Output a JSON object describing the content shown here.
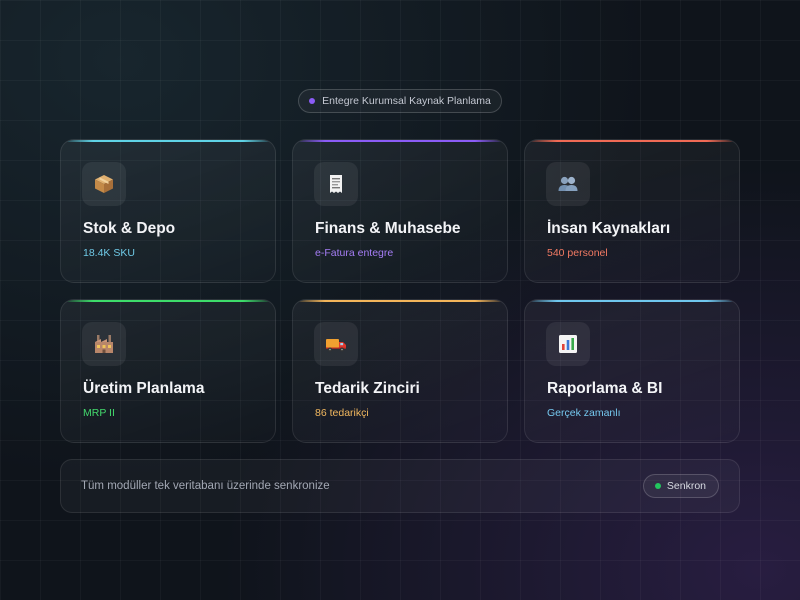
{
  "header": {
    "pill_label": "Entegre Kurumsal Kaynak Planlama",
    "dot_color": "#8b5cf6"
  },
  "modules": [
    {
      "title": "Stok & Depo",
      "subtitle": "18.4K SKU",
      "accent": "#5fd3e6",
      "sub_color": "#6fc9e6",
      "icon": "package-icon"
    },
    {
      "title": "Finans & Muhasebe",
      "subtitle": "e-Fatura entegre",
      "accent": "#8b5cf6",
      "sub_color": "#a57df5",
      "icon": "receipt-icon"
    },
    {
      "title": "İnsan Kaynakları",
      "subtitle": "540 personel",
      "accent": "#f06a55",
      "sub_color": "#f27a63",
      "icon": "people-icon"
    },
    {
      "title": "Üretim Planlama",
      "subtitle": "MRP II",
      "accent": "#3ddc6a",
      "sub_color": "#43d96c",
      "icon": "factory-icon"
    },
    {
      "title": "Tedarik Zinciri",
      "subtitle": "86 tedarikçi",
      "accent": "#f3b55a",
      "sub_color": "#f2b85f",
      "icon": "truck-icon"
    },
    {
      "title": "Raporlama & BI",
      "subtitle": "Gerçek zamanlı",
      "accent": "#6fc7ee",
      "sub_color": "#75c8ef",
      "icon": "bar-chart-icon"
    }
  ],
  "footer": {
    "message": "Tüm modüller tek veritabanı üzerinde senkronize",
    "status_label": "Senkron",
    "status_color": "#22c55e"
  }
}
